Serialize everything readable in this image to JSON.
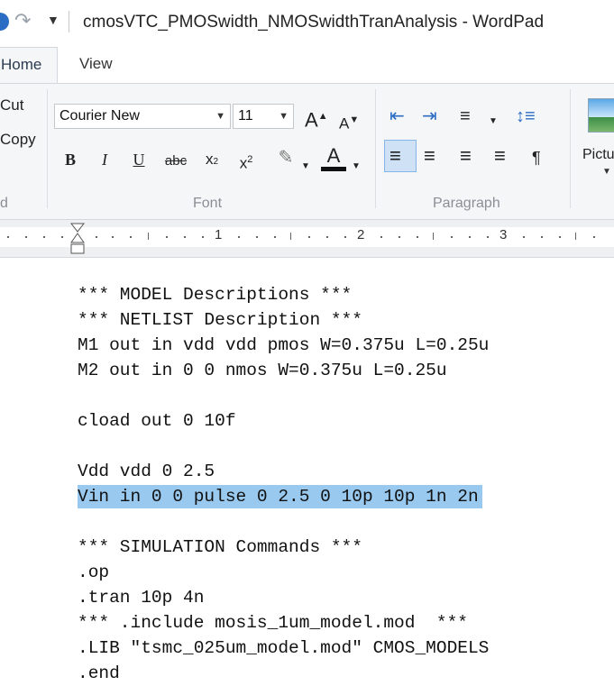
{
  "window": {
    "title": "cmosVTC_PMOSwidth_NMOSwidthTranAnalysis - WordPad"
  },
  "tabs": {
    "home": "Home",
    "view": "View"
  },
  "ribbon": {
    "clipboard": {
      "cut": "Cut",
      "copy": "Copy"
    },
    "font": {
      "family": "Courier New",
      "size": "11",
      "group_label": "Font"
    },
    "paragraph": {
      "group_label": "Paragraph"
    },
    "insert": {
      "picture": "Pictu"
    }
  },
  "ruler": {
    "numbers": [
      "1",
      "2",
      "3"
    ]
  },
  "document": {
    "lines": [
      "*** MODEL Descriptions ***",
      "*** NETLIST Description ***",
      "M1 out in vdd vdd pmos W=0.375u L=0.25u",
      "M2 out in 0 0 nmos W=0.375u L=0.25u",
      "",
      "cload out 0 10f",
      "",
      "Vdd vdd 0 2.5",
      "Vin in 0 0 pulse 0 2.5 0 10p 10p 1n 2n",
      "",
      "*** SIMULATION Commands ***",
      ".op",
      ".tran 10p 4n",
      "*** .include mosis_1um_model.mod  ***",
      ".LIB \"tsmc_025um_model.mod\" CMOS_MODELS",
      ".end"
    ],
    "selected_line_index": 8
  },
  "colors": {
    "selection": "#99c9ef",
    "ribbon_background": "#f5f6f7",
    "accent": "#2b6cc4"
  }
}
